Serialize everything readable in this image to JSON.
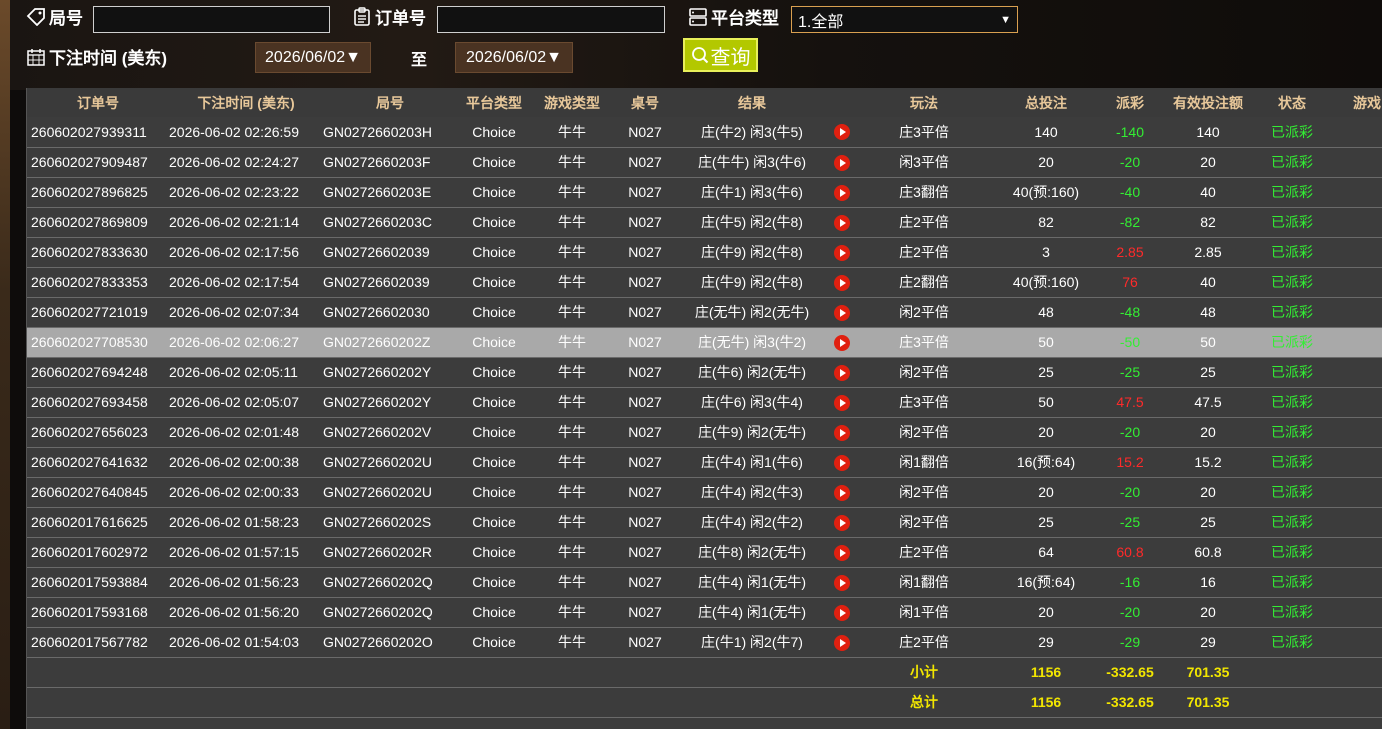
{
  "filters": {
    "round_label": "局号",
    "round_value": "",
    "order_label": "订单号",
    "order_value": "",
    "platform_label": "平台类型",
    "platform_selected": "1.全部",
    "bet_time_label": "下注时间 (美东)",
    "date_from": "2026/06/02",
    "to_label": "至",
    "date_to": "2026/06/02",
    "query_label": "查询"
  },
  "table": {
    "headers": [
      "订单号",
      "下注时间 (美东)",
      "局号",
      "平台类型",
      "游戏类型",
      "桌号",
      "结果",
      "",
      "玩法",
      "总投注",
      "派彩",
      "有效投注额",
      "状态",
      "游戏"
    ],
    "rows": [
      {
        "order": "260602027939311",
        "time": "2026-06-02 02:26:59",
        "round": "GN0272660203H",
        "platform": "Choice",
        "game": "牛牛",
        "table": "N027",
        "result": "庄(牛2) 闲3(牛5)",
        "play": "庄3平倍",
        "bet": "140",
        "payout": "-140",
        "payout_sign": "neg",
        "valid": "140",
        "status": "已派彩",
        "selected": false
      },
      {
        "order": "260602027909487",
        "time": "2026-06-02 02:24:27",
        "round": "GN0272660203F",
        "platform": "Choice",
        "game": "牛牛",
        "table": "N027",
        "result": "庄(牛牛) 闲3(牛6)",
        "play": "闲3平倍",
        "bet": "20",
        "payout": "-20",
        "payout_sign": "neg",
        "valid": "20",
        "status": "已派彩",
        "selected": false
      },
      {
        "order": "260602027896825",
        "time": "2026-06-02 02:23:22",
        "round": "GN0272660203E",
        "platform": "Choice",
        "game": "牛牛",
        "table": "N027",
        "result": "庄(牛1) 闲3(牛6)",
        "play": "庄3翻倍",
        "bet": "40(预:160)",
        "payout": "-40",
        "payout_sign": "neg",
        "valid": "40",
        "status": "已派彩",
        "selected": false
      },
      {
        "order": "260602027869809",
        "time": "2026-06-02 02:21:14",
        "round": "GN0272660203C",
        "platform": "Choice",
        "game": "牛牛",
        "table": "N027",
        "result": "庄(牛5) 闲2(牛8)",
        "play": "庄2平倍",
        "bet": "82",
        "payout": "-82",
        "payout_sign": "neg",
        "valid": "82",
        "status": "已派彩",
        "selected": false
      },
      {
        "order": "260602027833630",
        "time": "2026-06-02 02:17:56",
        "round": "GN02726602039",
        "platform": "Choice",
        "game": "牛牛",
        "table": "N027",
        "result": "庄(牛9) 闲2(牛8)",
        "play": "庄2平倍",
        "bet": "3",
        "payout": "2.85",
        "payout_sign": "pos",
        "valid": "2.85",
        "status": "已派彩",
        "selected": false
      },
      {
        "order": "260602027833353",
        "time": "2026-06-02 02:17:54",
        "round": "GN02726602039",
        "platform": "Choice",
        "game": "牛牛",
        "table": "N027",
        "result": "庄(牛9) 闲2(牛8)",
        "play": "庄2翻倍",
        "bet": "40(预:160)",
        "payout": "76",
        "payout_sign": "pos",
        "valid": "40",
        "status": "已派彩",
        "selected": false
      },
      {
        "order": "260602027721019",
        "time": "2026-06-02 02:07:34",
        "round": "GN02726602030",
        "platform": "Choice",
        "game": "牛牛",
        "table": "N027",
        "result": "庄(无牛) 闲2(无牛)",
        "play": "闲2平倍",
        "bet": "48",
        "payout": "-48",
        "payout_sign": "neg",
        "valid": "48",
        "status": "已派彩",
        "selected": false
      },
      {
        "order": "260602027708530",
        "time": "2026-06-02 02:06:27",
        "round": "GN0272660202Z",
        "platform": "Choice",
        "game": "牛牛",
        "table": "N027",
        "result": "庄(无牛) 闲3(牛2)",
        "play": "庄3平倍",
        "bet": "50",
        "payout": "-50",
        "payout_sign": "neg",
        "valid": "50",
        "status": "已派彩",
        "selected": true
      },
      {
        "order": "260602027694248",
        "time": "2026-06-02 02:05:11",
        "round": "GN0272660202Y",
        "platform": "Choice",
        "game": "牛牛",
        "table": "N027",
        "result": "庄(牛6) 闲2(无牛)",
        "play": "闲2平倍",
        "bet": "25",
        "payout": "-25",
        "payout_sign": "neg",
        "valid": "25",
        "status": "已派彩",
        "selected": false
      },
      {
        "order": "260602027693458",
        "time": "2026-06-02 02:05:07",
        "round": "GN0272660202Y",
        "platform": "Choice",
        "game": "牛牛",
        "table": "N027",
        "result": "庄(牛6) 闲3(牛4)",
        "play": "庄3平倍",
        "bet": "50",
        "payout": "47.5",
        "payout_sign": "pos",
        "valid": "47.5",
        "status": "已派彩",
        "selected": false
      },
      {
        "order": "260602027656023",
        "time": "2026-06-02 02:01:48",
        "round": "GN0272660202V",
        "platform": "Choice",
        "game": "牛牛",
        "table": "N027",
        "result": "庄(牛9) 闲2(无牛)",
        "play": "闲2平倍",
        "bet": "20",
        "payout": "-20",
        "payout_sign": "neg",
        "valid": "20",
        "status": "已派彩",
        "selected": false
      },
      {
        "order": "260602027641632",
        "time": "2026-06-02 02:00:38",
        "round": "GN0272660202U",
        "platform": "Choice",
        "game": "牛牛",
        "table": "N027",
        "result": "庄(牛4) 闲1(牛6)",
        "play": "闲1翻倍",
        "bet": "16(预:64)",
        "payout": "15.2",
        "payout_sign": "pos",
        "valid": "15.2",
        "status": "已派彩",
        "selected": false
      },
      {
        "order": "260602027640845",
        "time": "2026-06-02 02:00:33",
        "round": "GN0272660202U",
        "platform": "Choice",
        "game": "牛牛",
        "table": "N027",
        "result": "庄(牛4) 闲2(牛3)",
        "play": "闲2平倍",
        "bet": "20",
        "payout": "-20",
        "payout_sign": "neg",
        "valid": "20",
        "status": "已派彩",
        "selected": false
      },
      {
        "order": "260602017616625",
        "time": "2026-06-02 01:58:23",
        "round": "GN0272660202S",
        "platform": "Choice",
        "game": "牛牛",
        "table": "N027",
        "result": "庄(牛4) 闲2(牛2)",
        "play": "闲2平倍",
        "bet": "25",
        "payout": "-25",
        "payout_sign": "neg",
        "valid": "25",
        "status": "已派彩",
        "selected": false
      },
      {
        "order": "260602017602972",
        "time": "2026-06-02 01:57:15",
        "round": "GN0272660202R",
        "platform": "Choice",
        "game": "牛牛",
        "table": "N027",
        "result": "庄(牛8) 闲2(无牛)",
        "play": "庄2平倍",
        "bet": "64",
        "payout": "60.8",
        "payout_sign": "pos",
        "valid": "60.8",
        "status": "已派彩",
        "selected": false
      },
      {
        "order": "260602017593884",
        "time": "2026-06-02 01:56:23",
        "round": "GN0272660202Q",
        "platform": "Choice",
        "game": "牛牛",
        "table": "N027",
        "result": "庄(牛4) 闲1(无牛)",
        "play": "闲1翻倍",
        "bet": "16(预:64)",
        "payout": "-16",
        "payout_sign": "neg",
        "valid": "16",
        "status": "已派彩",
        "selected": false
      },
      {
        "order": "260602017593168",
        "time": "2026-06-02 01:56:20",
        "round": "GN0272660202Q",
        "platform": "Choice",
        "game": "牛牛",
        "table": "N027",
        "result": "庄(牛4) 闲1(无牛)",
        "play": "闲1平倍",
        "bet": "20",
        "payout": "-20",
        "payout_sign": "neg",
        "valid": "20",
        "status": "已派彩",
        "selected": false
      },
      {
        "order": "260602017567782",
        "time": "2026-06-02 01:54:03",
        "round": "GN0272660202O",
        "platform": "Choice",
        "game": "牛牛",
        "table": "N027",
        "result": "庄(牛1) 闲2(牛7)",
        "play": "庄2平倍",
        "bet": "29",
        "payout": "-29",
        "payout_sign": "neg",
        "valid": "29",
        "status": "已派彩",
        "selected": false
      }
    ],
    "subtotal": {
      "label": "小计",
      "bet": "1156",
      "payout": "-332.65",
      "valid": "701.35"
    },
    "total": {
      "label": "总计",
      "bet": "1156",
      "payout": "-332.65",
      "valid": "701.35"
    }
  },
  "colors": {
    "positive": "#ff2a2a",
    "negative": "#33ee33",
    "status": "#33ee33",
    "header_text": "#e8c89a",
    "sum_text": "#f2e600"
  }
}
